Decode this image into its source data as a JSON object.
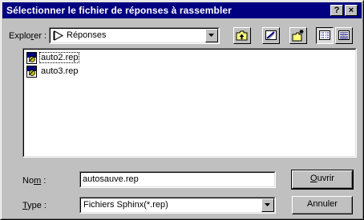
{
  "window": {
    "title": "Sélectionner le fichier de réponses à rassembler",
    "help_label": "?",
    "close_label": "×"
  },
  "lookin": {
    "label_pre": "Explo",
    "label_accel": "r",
    "label_post": "er :",
    "value": "Réponses",
    "icon": "folder-arrow-icon"
  },
  "toolbar": {
    "buttons": [
      {
        "name": "up-one-level",
        "icon": "up-folder-icon"
      },
      {
        "name": "desktop",
        "icon": "desktop-icon"
      },
      {
        "name": "new-folder",
        "icon": "new-folder-icon"
      },
      {
        "name": "list-view",
        "icon": "list-view-icon"
      },
      {
        "name": "details-view",
        "icon": "details-view-icon"
      }
    ]
  },
  "files": [
    {
      "name": "auto2.rep",
      "icon": "sphinx-file-icon"
    },
    {
      "name": "auto3.rep",
      "icon": "sphinx-file-icon"
    }
  ],
  "filename": {
    "label_pre": "No",
    "label_accel": "m",
    "label_post": " :",
    "value": "autosauve.rep"
  },
  "filetype": {
    "label_pre": "",
    "label_accel": "T",
    "label_post": "ype :",
    "value": "Fichiers Sphinx(*.rep)"
  },
  "buttons": {
    "open_accel": "O",
    "open_rest": "uvrir",
    "cancel": "Annuler"
  },
  "colors": {
    "titlebar": "#000080",
    "face": "#c0c0c0"
  }
}
